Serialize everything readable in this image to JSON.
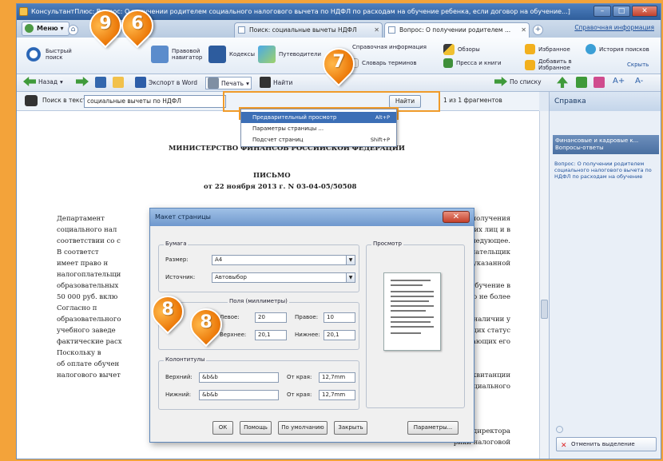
{
  "window": {
    "title": "КонсультантПлюс: Вопрос: О получении родителем социального налогового вычета по НДФЛ по расходам на обучение ребенка, если договор на обучение...]",
    "controls": {
      "min": "–",
      "max": "□",
      "close": "✕"
    }
  },
  "tabs": {
    "menu_label": "Меню",
    "items": [
      {
        "label": "Поиск: социальные вычеты НДФЛ"
      },
      {
        "label": "Вопрос: О получении родителем ..."
      }
    ],
    "right_link": "Справочная информация"
  },
  "ribbon": {
    "quick_search": "Быстрый поиск",
    "legal_navigator": "Правовой навигатор",
    "codes": "Кодексы",
    "guides": "Путеводители",
    "reference": "Справочная информация",
    "reviews": "Обзоры",
    "dictionary": "Словарь терминов",
    "press": "Пресса и книги",
    "favorites": "Избранное",
    "add_favorite": "Добавить в Избранное",
    "history": "История поисков",
    "hide": "Скрыть"
  },
  "navbar": {
    "back": "Назад",
    "export_word": "Экспорт в Word",
    "print": "Печать",
    "find": "Найти",
    "by_list": "По списку",
    "font_up": "A+",
    "font_down": "A-"
  },
  "searchbar": {
    "label": "Поиск в тексте",
    "value": "социальные вычеты по НДФЛ",
    "find_button": "Найти",
    "count": "1 из 1 фрагментов"
  },
  "print_menu": [
    {
      "label": "Предварительный просмотр",
      "shortcut": "Alt+P"
    },
    {
      "label": "Параметры страницы ...",
      "shortcut": ""
    },
    {
      "label": "Подсчет страниц",
      "shortcut": "Shift+P"
    }
  ],
  "document": {
    "ministry": "МИНИСТЕРСТВО ФИНАНСОВ РОССИЙСКОЙ ФЕДЕРАЦИИ",
    "letter_title": "ПИСЬМО",
    "letter_date": "от 22 ноября 2013 г. N 03-04-05/50508",
    "lines": [
      "Департамент",
      "социального нал",
      "соответствии со с",
      "В соответст",
      "имеет право н",
      "налогоплательщи",
      "образовательных",
      "50 000 руб. вклю",
      "Согласно п",
      "образовательного",
      "учебного заведе",
      "фактические расх",
      "Поскольку в",
      "об оплате обучен",
      "налогового вычет"
    ],
    "right_lines": [
      "су получения",
      "ских лиц и в",
      "следующее.",
      "о налогоплательщик",
      "указанной",
      "за обучение в",
      "а, но не более",
      "при наличии у",
      "вающих статус",
      "дающих его",
      "ой и квитанции",
      "социального",
      "ель директора",
      "рики налоговой"
    ]
  },
  "sidepanel": {
    "title": "Справка",
    "selected": "Финансовые и кадровые к... Вопросы-ответы",
    "text": "Вопрос: О получении родителем социального налогового вычета по НДФЛ по расходам на обучение",
    "cancel": "Отменить выделение"
  },
  "dialog": {
    "title": "Макет страницы",
    "paper_group": "Бумага",
    "size_label": "Размер:",
    "size_value": "A4",
    "source_label": "Источник:",
    "source_value": "Автовыбор",
    "preview_group": "Просмотр",
    "margins_group": "Поля (миллиметры)",
    "left_label": "Левое:",
    "left_value": "20",
    "right_label": "Правое:",
    "right_value": "10",
    "top_label": "Верхнее:",
    "top_value": "20,1",
    "bottom_label": "Нижнее:",
    "bottom_value": "20,1",
    "headers_group": "Колонтитулы",
    "header_label": "Верхний:",
    "header_value": "&b&b",
    "footer_label": "Нижний:",
    "footer_value": "&b&b",
    "header_edge_label": "От края:",
    "header_edge_value": "12,7mm",
    "footer_edge_label": "От края:",
    "footer_edge_value": "12,7mm",
    "buttons": {
      "ok": "ОК",
      "help": "Помощь",
      "default": "По умолчанию",
      "close": "Закрыть",
      "params": "Параметры..."
    }
  },
  "markers": [
    "9",
    "6",
    "7",
    "8",
    "8"
  ],
  "colors": {
    "accent": "#3c6fb6",
    "marker": "#ec7a0a",
    "frame": "#f3a33a"
  }
}
